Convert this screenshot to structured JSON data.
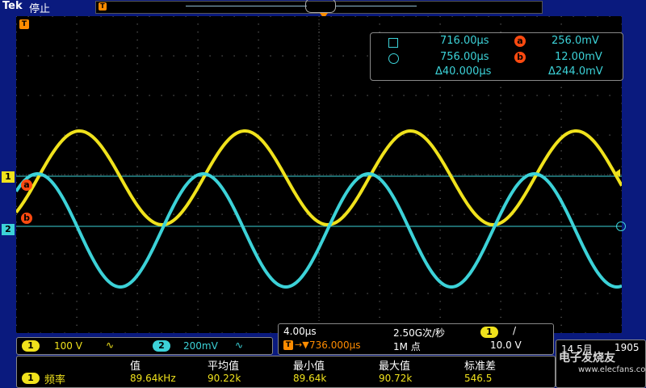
{
  "header": {
    "brand": "Tek",
    "run_status": "停止",
    "trigger_marker_label": "T"
  },
  "cursor_readout": {
    "cursor_a_time": "716.00µs",
    "cursor_b_time": "756.00µs",
    "delta_time": "Δ40.000µs",
    "cursor_a_value": "256.0mV",
    "cursor_b_value": "12.00mV",
    "delta_value": "Δ244.0mV",
    "badge_a": "a",
    "badge_b": "b"
  },
  "markers": {
    "ch1": "1",
    "ch2": "2",
    "ref_a": "a",
    "ref_b": "b",
    "trigger_t": "T"
  },
  "channels": [
    {
      "num": "1",
      "scale": "100 V",
      "coupling": "∿",
      "color": "#f0e21c"
    },
    {
      "num": "2",
      "scale": "200mV",
      "coupling": "∿",
      "color": "#3cd2d8"
    }
  ],
  "timebase": {
    "time_per_div": "4.00µs",
    "sample_rate": "2.50G次/秒",
    "trigger_pos": "736.000µs",
    "record_length": "1M 点",
    "trigger_source": "1",
    "trigger_slope": "/",
    "trigger_level": "10.0 V"
  },
  "measurement": {
    "headers": [
      "值",
      "平均值",
      "最小值",
      "最大值",
      "标准差"
    ],
    "row_source": "1",
    "row_label": "频率",
    "values": [
      "89.64kHz",
      "90.22k",
      "89.64k",
      "90.72k",
      "546.5"
    ]
  },
  "datetime": {
    "date": "14 5月",
    "time": "1905"
  },
  "watermark": {
    "main": "电子发烧友",
    "sub": "www.elecfans.com"
  },
  "colors": {
    "ch1": "#f0e21c",
    "ch2": "#3cd2d8",
    "cursor_badge": "#ff4a10",
    "trigger": "#ff8c00",
    "frame": "#0a1a7e"
  }
}
